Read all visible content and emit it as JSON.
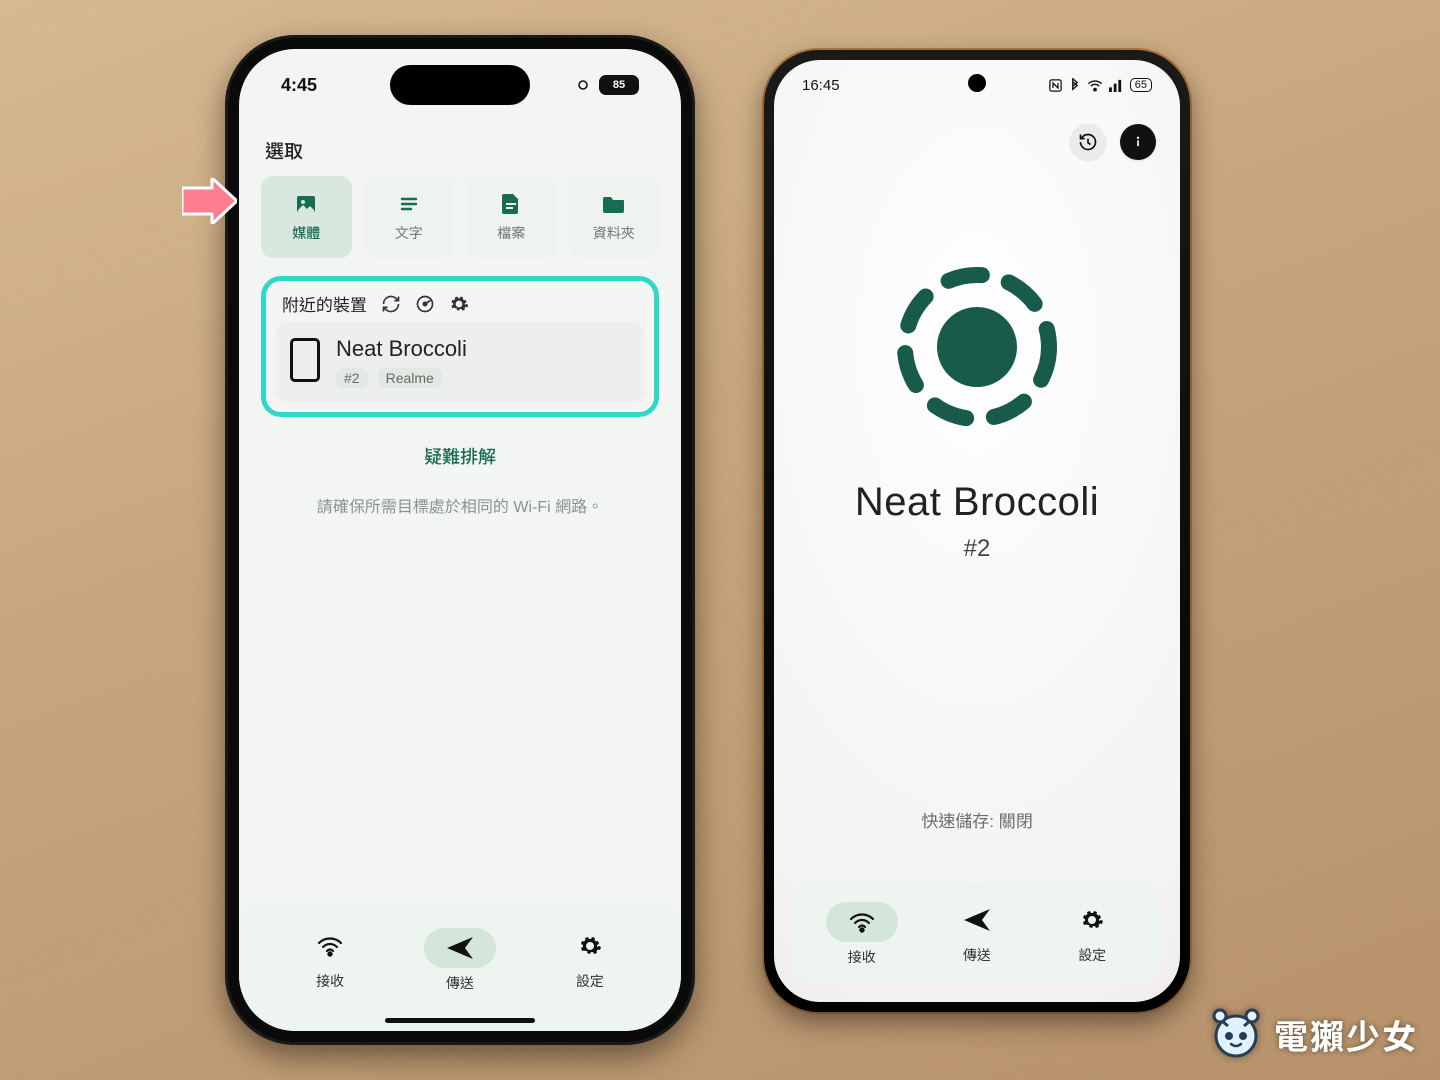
{
  "annotation": {
    "arrow_color": "#ff7e8f",
    "highlight_color": "#2fd8c9"
  },
  "watermark": {
    "text": "電獺少女"
  },
  "iphone": {
    "status": {
      "time": "4:45",
      "battery": "85"
    },
    "section_title": "選取",
    "media_tabs": [
      {
        "key": "media",
        "label": "媒體",
        "icon": "image-icon",
        "active": true
      },
      {
        "key": "text",
        "label": "文字",
        "icon": "text-lines-icon"
      },
      {
        "key": "file",
        "label": "檔案",
        "icon": "file-icon"
      },
      {
        "key": "folder",
        "label": "資料夾",
        "icon": "folder-icon"
      }
    ],
    "nearby": {
      "title": "附近的裝置",
      "device": {
        "name": "Neat Broccoli",
        "tags": [
          "#2",
          "Realme"
        ]
      }
    },
    "troubleshoot": "疑難排解",
    "hint": "請確保所需目標處於相同的 Wi-Fi 網路。",
    "tabs": {
      "receive": "接收",
      "send": "傳送",
      "settings": "設定"
    }
  },
  "android": {
    "status": {
      "time": "16:45",
      "battery": "65"
    },
    "title": "Neat Broccoli",
    "subtitle": "#2",
    "quick_save": "快速儲存: 關閉",
    "tabs": {
      "receive": "接收",
      "send": "傳送",
      "settings": "設定"
    }
  }
}
